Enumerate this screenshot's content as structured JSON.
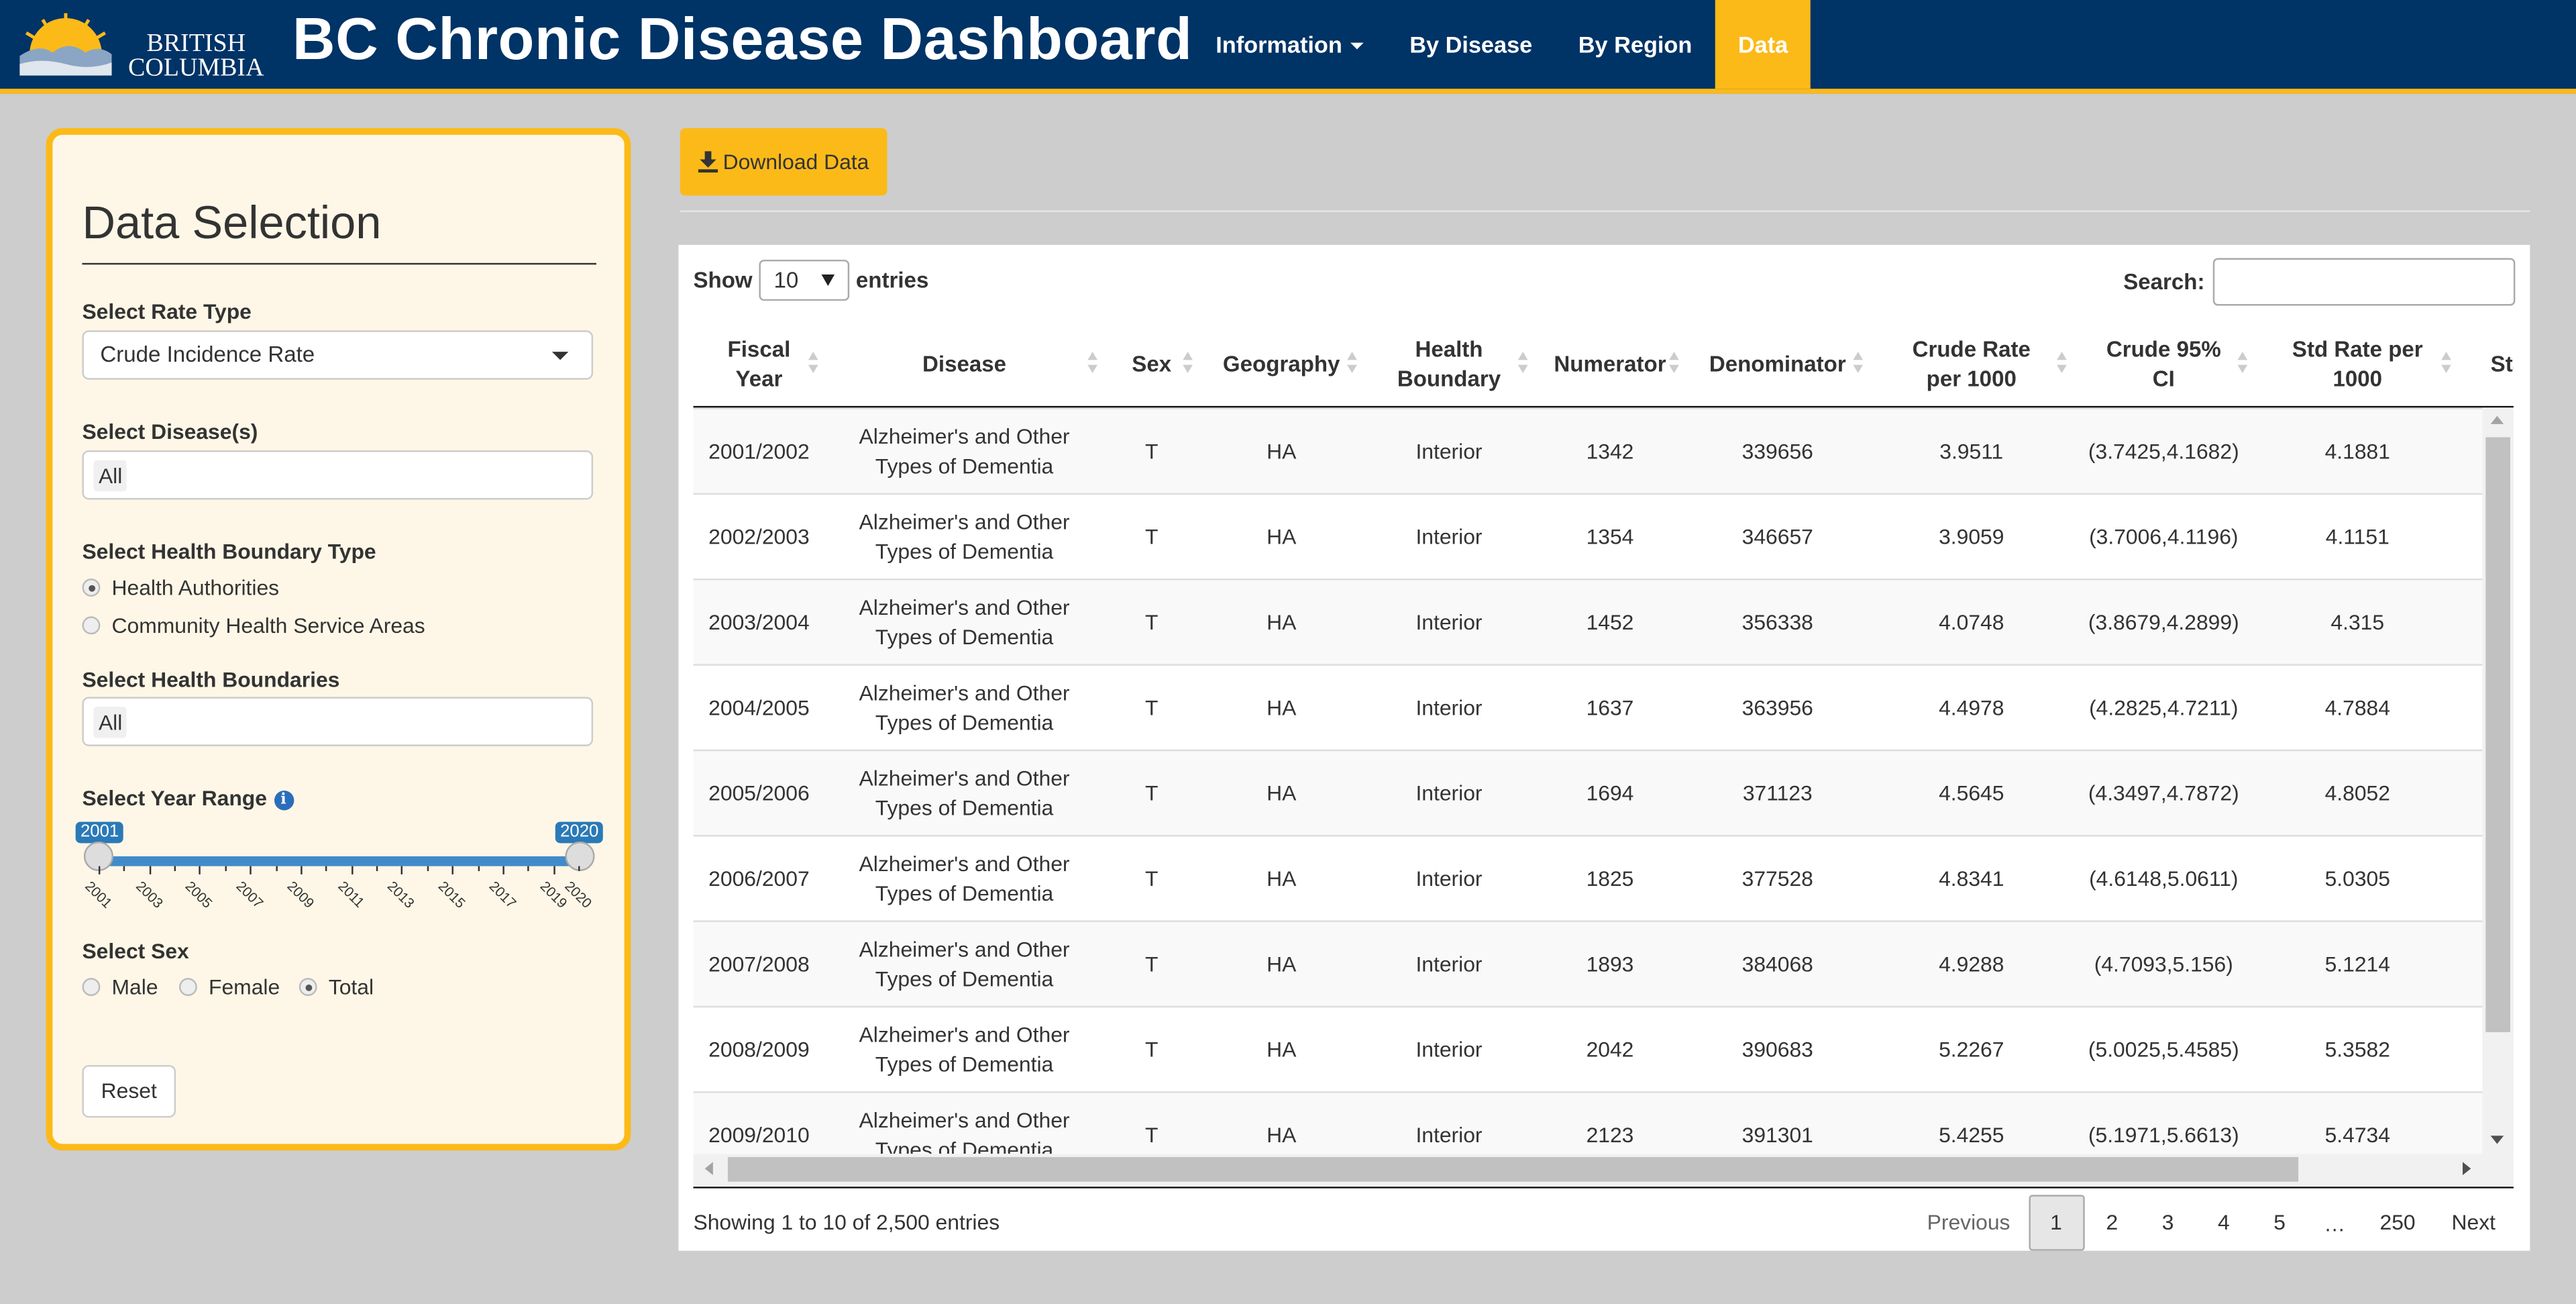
{
  "header": {
    "logo_line1": "BRITISH",
    "logo_line2": "COLUMBIA",
    "title": "BC Chronic Disease Dashboard",
    "nav": [
      {
        "label": "Information",
        "has_caret": true
      },
      {
        "label": "By Disease"
      },
      {
        "label": "By Region"
      },
      {
        "label": "Data",
        "active": true
      }
    ],
    "colors": {
      "navy": "#003366",
      "gold": "#fcba19"
    }
  },
  "sidebar": {
    "title": "Data Selection",
    "rate_type_label": "Select Rate Type",
    "rate_type_value": "Crude Incidence Rate",
    "disease_label": "Select Disease(s)",
    "disease_value": "All",
    "boundary_type_label": "Select Health Boundary Type",
    "boundary_type_options": [
      {
        "label": "Health Authorities",
        "checked": true
      },
      {
        "label": "Community Health Service Areas",
        "checked": false
      }
    ],
    "boundaries_label": "Select Health Boundaries",
    "boundaries_value": "All",
    "year_range_label": "Select Year Range",
    "year_range_min": "2001",
    "year_range_max": "2020",
    "year_ticks": [
      "2001",
      "2003",
      "2005",
      "2007",
      "2009",
      "2011",
      "2013",
      "2015",
      "2017",
      "2019",
      "2020"
    ],
    "sex_label": "Select Sex",
    "sex_options": [
      {
        "label": "Male",
        "checked": false
      },
      {
        "label": "Female",
        "checked": false
      },
      {
        "label": "Total",
        "checked": true
      }
    ],
    "reset_label": "Reset"
  },
  "main": {
    "download_label": "Download Data",
    "show_label": "Show",
    "entries_label": "entries",
    "page_length": "10",
    "search_label": "Search:",
    "search_value": "",
    "columns": [
      "Fiscal Year",
      "Disease",
      "Sex",
      "Geography",
      "Health Boundary",
      "Numerator",
      "Denominator",
      "Crude Rate per 1000",
      "Crude 95% CI",
      "Std Rate per 1000",
      "Sta"
    ],
    "rows": [
      [
        "2001/2002",
        "Alzheimer's and Other Types of Dementia",
        "T",
        "HA",
        "Interior",
        "1342",
        "339656",
        "3.9511",
        "(3.7425,4.1682)",
        "4.1881"
      ],
      [
        "2002/2003",
        "Alzheimer's and Other Types of Dementia",
        "T",
        "HA",
        "Interior",
        "1354",
        "346657",
        "3.9059",
        "(3.7006,4.1196)",
        "4.1151"
      ],
      [
        "2003/2004",
        "Alzheimer's and Other Types of Dementia",
        "T",
        "HA",
        "Interior",
        "1452",
        "356338",
        "4.0748",
        "(3.8679,4.2899)",
        "4.315"
      ],
      [
        "2004/2005",
        "Alzheimer's and Other Types of Dementia",
        "T",
        "HA",
        "Interior",
        "1637",
        "363956",
        "4.4978",
        "(4.2825,4.7211)",
        "4.7884"
      ],
      [
        "2005/2006",
        "Alzheimer's and Other Types of Dementia",
        "T",
        "HA",
        "Interior",
        "1694",
        "371123",
        "4.5645",
        "(4.3497,4.7872)",
        "4.8052"
      ],
      [
        "2006/2007",
        "Alzheimer's and Other Types of Dementia",
        "T",
        "HA",
        "Interior",
        "1825",
        "377528",
        "4.8341",
        "(4.6148,5.0611)",
        "5.0305"
      ],
      [
        "2007/2008",
        "Alzheimer's and Other Types of Dementia",
        "T",
        "HA",
        "Interior",
        "1893",
        "384068",
        "4.9288",
        "(4.7093,5.156)",
        "5.1214"
      ],
      [
        "2008/2009",
        "Alzheimer's and Other Types of Dementia",
        "T",
        "HA",
        "Interior",
        "2042",
        "390683",
        "5.2267",
        "(5.0025,5.4585)",
        "5.3582"
      ],
      [
        "2009/2010",
        "Alzheimer's and Other Types of Dementia",
        "T",
        "HA",
        "Interior",
        "2123",
        "391301",
        "5.4255",
        "(5.1971,5.6613)",
        "5.4734"
      ]
    ],
    "info": "Showing 1 to 10 of 2,500 entries",
    "pagination": {
      "previous": "Previous",
      "pages": [
        "1",
        "2",
        "3",
        "4",
        "5"
      ],
      "ellipsis": "…",
      "last": "250",
      "next": "Next",
      "current": "1"
    }
  }
}
